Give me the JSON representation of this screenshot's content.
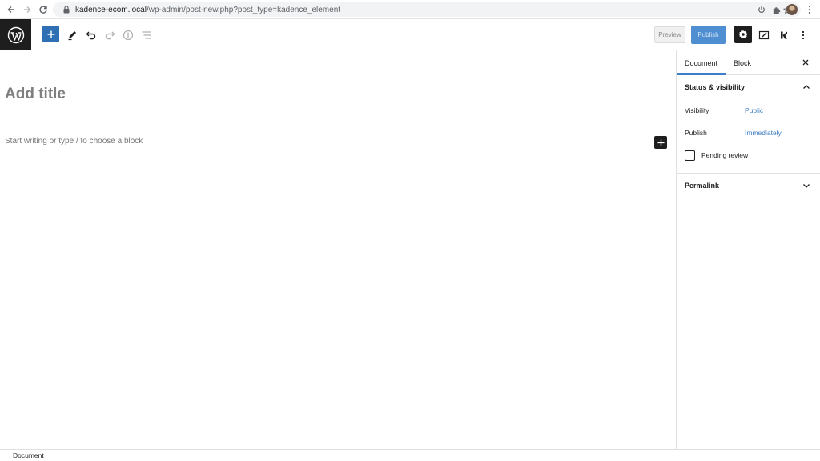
{
  "browser": {
    "url_host": "kadence-ecom.local",
    "url_path": "/wp-admin/post-new.php?post_type=kadence_element"
  },
  "header": {
    "preview_label": "Preview",
    "publish_label": "Publish"
  },
  "editor": {
    "title_placeholder": "Add title",
    "block_placeholder": "Start writing or type / to choose a block"
  },
  "sidebar": {
    "tabs": [
      {
        "label": "Document",
        "active": true
      },
      {
        "label": "Block",
        "active": false
      }
    ],
    "status_panel": {
      "title": "Status & visibility",
      "visibility_label": "Visibility",
      "visibility_value": "Public",
      "publish_label": "Publish",
      "publish_value": "Immediately",
      "pending_review_label": "Pending review"
    },
    "permalink_title": "Permalink"
  },
  "footer": {
    "breadcrumb": "Document"
  },
  "colors": {
    "accent": "#3d7ec6",
    "link": "#3b7bbf",
    "dark": "#1e1e1e"
  },
  "icons": [
    "back-arrow-icon",
    "forward-arrow-icon",
    "reload-icon",
    "lock-icon",
    "star-icon",
    "power-icon",
    "extensions-icon",
    "wordpress-logo-icon",
    "plus-icon",
    "pencil-icon",
    "undo-icon",
    "redo-icon",
    "info-icon",
    "list-view-icon",
    "gear-icon",
    "editor-style-icon",
    "kadence-logo-icon",
    "kebab-menu-icon",
    "close-icon",
    "chevron-up-icon",
    "chevron-down-icon"
  ]
}
